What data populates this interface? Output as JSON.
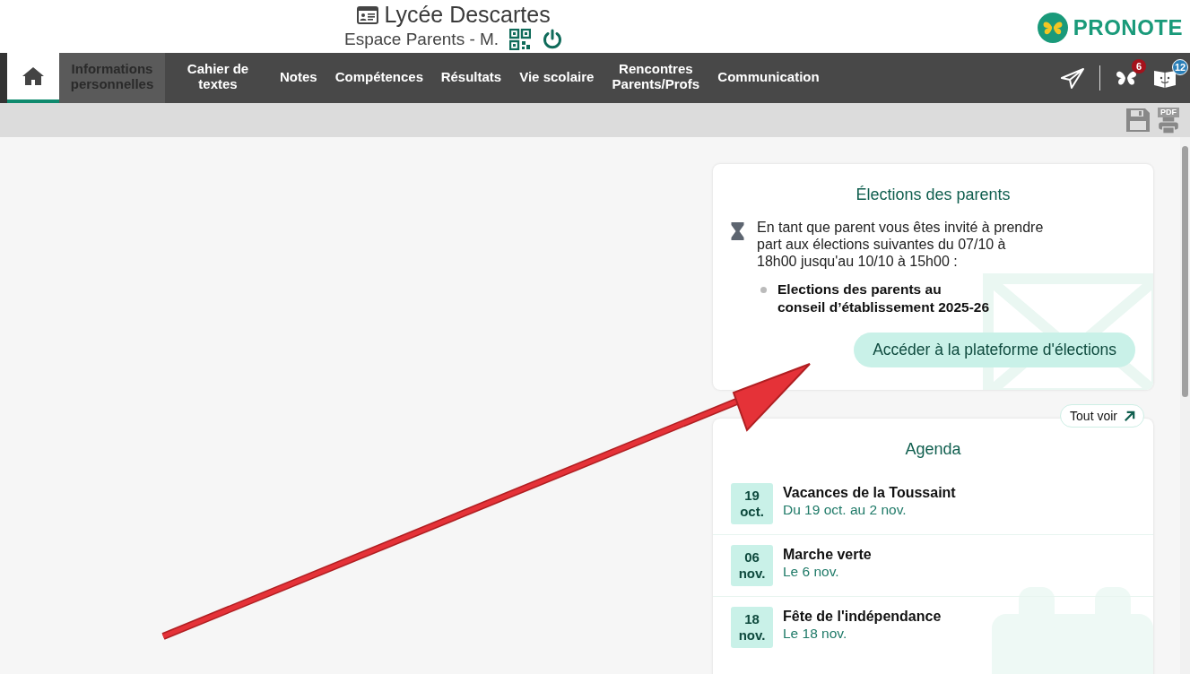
{
  "header": {
    "school": "Lycée Descartes",
    "space": "Espace Parents - M.",
    "logo": "PRONOTE"
  },
  "nav": [
    {
      "kind": "home",
      "selected": true,
      "disabled": false
    },
    {
      "kind": "text",
      "label": "Informations personnelles",
      "selected": false,
      "disabled": true
    },
    {
      "kind": "text",
      "label": "Cahier de textes",
      "selected": false,
      "disabled": false
    },
    {
      "kind": "text",
      "label": "Notes",
      "selected": false,
      "disabled": false
    },
    {
      "kind": "text",
      "label": "Compétences",
      "selected": false,
      "disabled": false
    },
    {
      "kind": "text",
      "label": "Résultats",
      "selected": false,
      "disabled": false
    },
    {
      "kind": "text",
      "label": "Vie scolaire",
      "selected": false,
      "disabled": false
    },
    {
      "kind": "text",
      "label": "Rencontres Parents/Profs",
      "selected": false,
      "disabled": false
    },
    {
      "kind": "text",
      "label": "Communication",
      "selected": false,
      "disabled": false
    }
  ],
  "nav_badges": [
    "6",
    "12"
  ],
  "toolbar": {
    "pdf_label": "PDF"
  },
  "elections": {
    "title": "Élections des parents",
    "message": "En tant que parent vous êtes invité à prendre part aux élections suivantes du 07/10 à 18h00 jusqu'au 10/10 à 15h00 :",
    "items": [
      "Elections des parents au conseil d’établissement 2025-26"
    ],
    "button": "Accéder à la plateforme d'élections"
  },
  "agenda": {
    "see_all": "Tout voir",
    "title": "Agenda",
    "events": [
      {
        "day": "19",
        "month": "oct.",
        "title": "Vacances de la Toussaint",
        "when": "Du 19 oct. au 2 nov."
      },
      {
        "day": "06",
        "month": "nov.",
        "title": "Marche verte",
        "when": "Le 6 nov."
      },
      {
        "day": "18",
        "month": "nov.",
        "title": "Fête de l'indépendance",
        "when": "Le 18 nov."
      }
    ]
  }
}
